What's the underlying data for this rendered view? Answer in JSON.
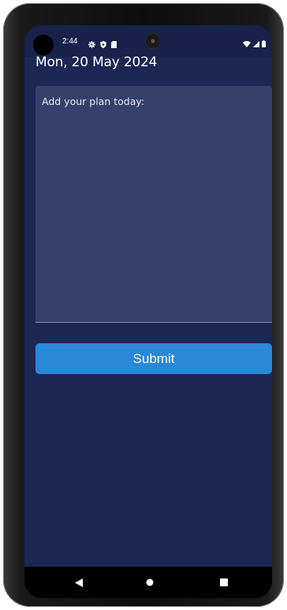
{
  "status_bar": {
    "time": "2:44",
    "icons": [
      "gear-icon",
      "shield-icon",
      "sim-card-icon"
    ],
    "right_icons": [
      "wifi-icon",
      "signal-icon",
      "battery-icon"
    ]
  },
  "header": {
    "date": "Mon, 20 May 2024"
  },
  "plan_input": {
    "placeholder": "Add your plan today:",
    "value": ""
  },
  "submit_button": {
    "label": "Submit",
    "color": "#2a88d8"
  },
  "nav_bar": {
    "buttons": [
      "back-icon",
      "home-icon",
      "recents-icon"
    ]
  },
  "colors": {
    "background": "#1c2755",
    "input_background": "#33416b",
    "accent": "#2a88d8"
  }
}
